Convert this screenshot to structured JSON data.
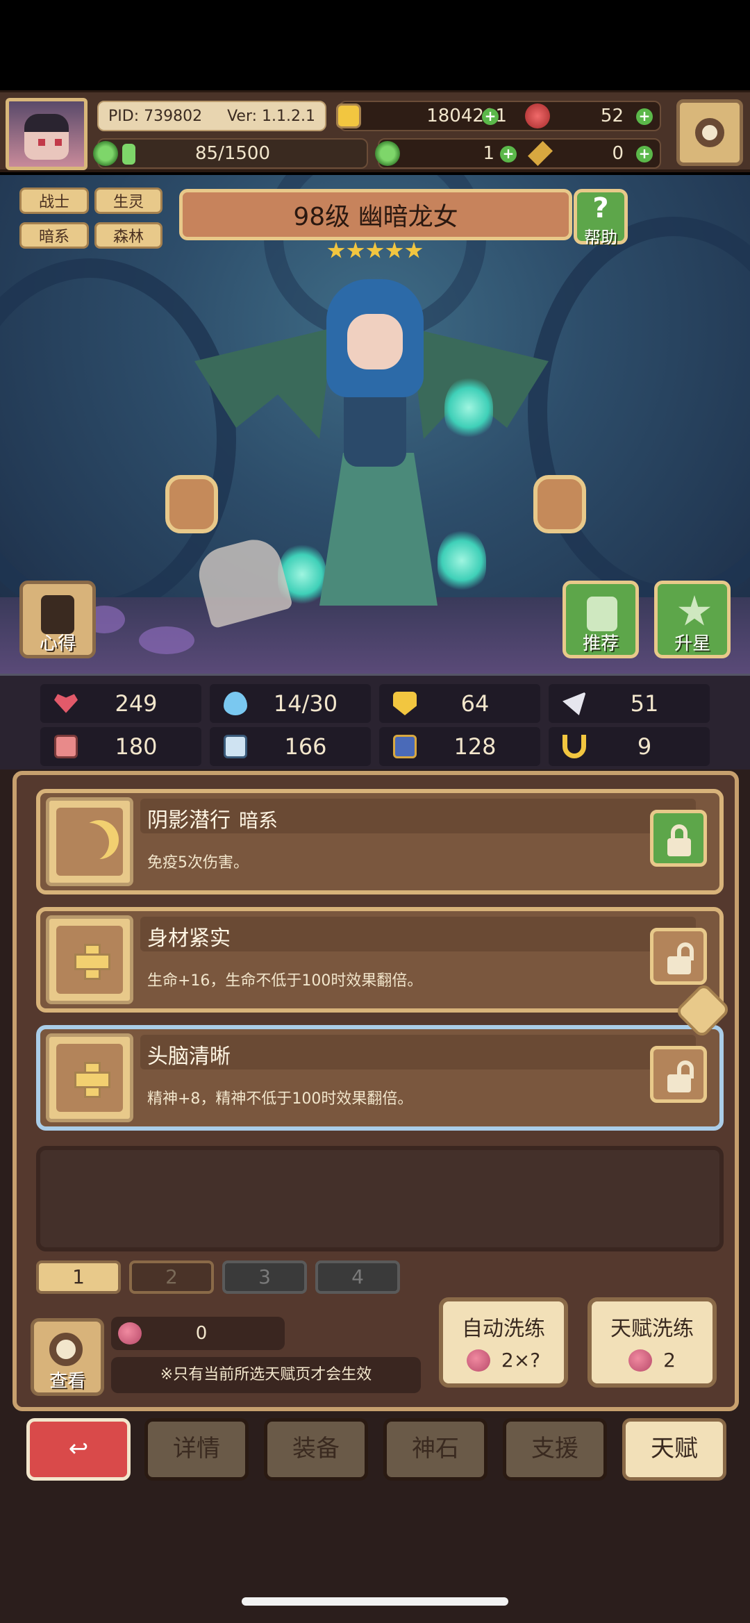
{
  "header": {
    "pid_label": "PID: 739802",
    "version_label": "Ver: 1.1.2.1",
    "xp_text": "85/1500",
    "xp_fraction": 0.057,
    "gold": "1804291",
    "gems": "52",
    "clover": "1",
    "key": "0"
  },
  "hero": {
    "tags": [
      "战士",
      "生灵",
      "暗系",
      "森林"
    ],
    "title": "98级 幽暗龙女",
    "stars": 5,
    "help_label": "帮助",
    "notes_label": "心得",
    "recommend_label": "推荐",
    "star_up_label": "升星"
  },
  "stats": [
    "249",
    "14/30",
    "64",
    "51",
    "180",
    "166",
    "128",
    "9"
  ],
  "talents": [
    {
      "name": "阴影潜行",
      "tag": "暗系",
      "desc": "免疫5次伤害。",
      "locked": true
    },
    {
      "name": "身材紧实",
      "tag": "",
      "desc": "生命+16，生命不低于100时效果翻倍。",
      "locked": false
    },
    {
      "name": "头脑清晰",
      "tag": "",
      "desc": "精神+8，精神不低于100时效果翻倍。",
      "locked": false
    }
  ],
  "pages": [
    "1",
    "2",
    "3",
    "4"
  ],
  "bottom": {
    "view_label": "查看",
    "resource_count": "0",
    "note": "※只有当前所选天赋页才会生效",
    "auto_reroll_label": "自动洗练",
    "auto_reroll_cost": "2×?",
    "talent_reroll_label": "天赋洗练",
    "talent_reroll_cost": "2"
  },
  "nav": {
    "details": "详情",
    "equip": "装备",
    "stone": "神石",
    "support": "支援",
    "talent": "天赋"
  },
  "colors": {
    "accent_gold": "#e8c98a",
    "panel_brown": "#55392e",
    "back_red": "#d94a4a",
    "green_button": "#5da64a"
  }
}
